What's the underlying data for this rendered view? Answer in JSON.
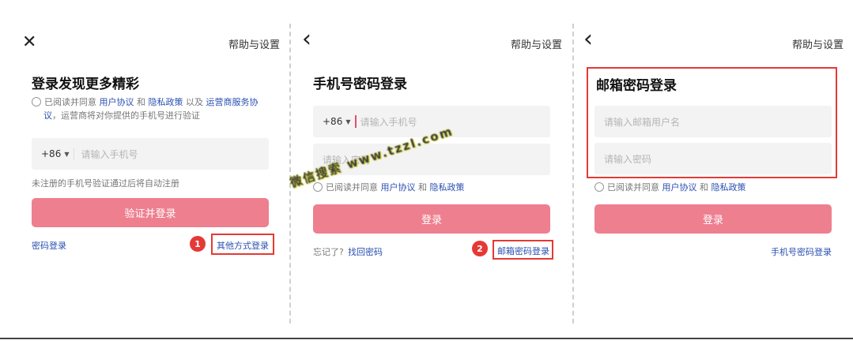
{
  "panel1": {
    "close_icon": "✕",
    "help": "帮助与设置",
    "title": "登录发现更多精彩",
    "agreement": {
      "prefix": "已阅读并同意 ",
      "user_agreement": "用户协议",
      "and": " 和 ",
      "privacy": "隐私政策",
      "and2": " 以及 ",
      "operator": "运营商服务协",
      "operator2": "议",
      "suffix": "，运营商将对你提供的手机号进行验证"
    },
    "country_code": "+86",
    "phone_placeholder": "请输入手机号",
    "hint": "未注册的手机号验证通过后将自动注册",
    "submit": "验证并登录",
    "password_login": "密码登录",
    "other_login": "其他方式登录",
    "badge": "1"
  },
  "panel2": {
    "back_icon": "‹",
    "help": "帮助与设置",
    "title": "手机号密码登录",
    "country_code": "+86",
    "phone_placeholder": "请输入手机号",
    "password_placeholder": "请输入密码",
    "agreement": {
      "prefix": "已阅读并同意 ",
      "user_agreement": "用户协议",
      "and": " 和 ",
      "privacy": "隐私政策"
    },
    "submit": "登录",
    "forgot": "忘记了?",
    "find_password": "找回密码",
    "email_login": "邮箱密码登录",
    "badge": "2",
    "watermark": "微信搜索 www.tzzl.com"
  },
  "panel3": {
    "back_icon": "‹",
    "help": "帮助与设置",
    "title": "邮箱密码登录",
    "email_placeholder": "请输入邮箱用户名",
    "password_placeholder": "请输入密码",
    "agreement": {
      "prefix": "已阅读并同意 ",
      "user_agreement": "用户协议",
      "and": " 和 ",
      "privacy": "隐私政策"
    },
    "submit": "登录",
    "phone_login": "手机号密码登录"
  },
  "colors": {
    "button": "#ee7f8f",
    "link": "#2a4fb0",
    "highlight": "#e53935"
  }
}
